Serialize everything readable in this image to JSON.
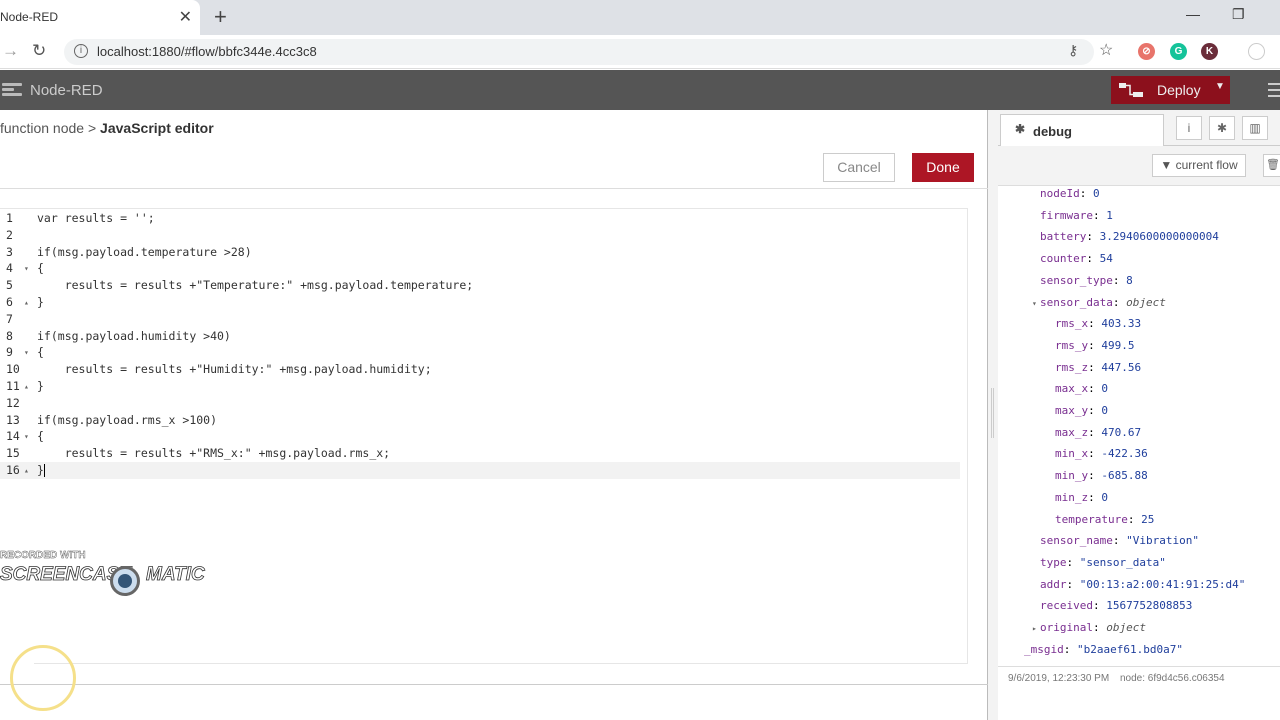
{
  "browser": {
    "tab_title": "Node-RED",
    "url": "localhost:1880/#flow/bbfc344e.4cc3c8"
  },
  "header": {
    "title": "Node-RED",
    "deploy_label": "Deploy"
  },
  "editor": {
    "breadcrumb_parent": "function node",
    "breadcrumb_sep": ">",
    "breadcrumb_current": "JavaScript editor",
    "cancel_label": "Cancel",
    "done_label": "Done",
    "lines": [
      {
        "n": "1",
        "fold": "",
        "text": "var results = '';"
      },
      {
        "n": "2",
        "fold": "",
        "text": ""
      },
      {
        "n": "3",
        "fold": "",
        "text": "if(msg.payload.temperature >28)"
      },
      {
        "n": "4",
        "fold": "▾",
        "text": "{"
      },
      {
        "n": "5",
        "fold": "",
        "text": "    results = results +\"Temperature:\" +msg.payload.temperature;"
      },
      {
        "n": "6",
        "fold": "▴",
        "text": "}"
      },
      {
        "n": "7",
        "fold": "",
        "text": ""
      },
      {
        "n": "8",
        "fold": "",
        "text": "if(msg.payload.humidity >40)"
      },
      {
        "n": "9",
        "fold": "▾",
        "text": "{"
      },
      {
        "n": "10",
        "fold": "",
        "text": "    results = results +\"Humidity:\" +msg.payload.humidity;"
      },
      {
        "n": "11",
        "fold": "▴",
        "text": "}"
      },
      {
        "n": "12",
        "fold": "",
        "text": ""
      },
      {
        "n": "13",
        "fold": "",
        "text": "if(msg.payload.rms_x >100)"
      },
      {
        "n": "14",
        "fold": "▾",
        "text": "{"
      },
      {
        "n": "15",
        "fold": "",
        "text": "    results = results +\"RMS_x:\" +msg.payload.rms_x;"
      },
      {
        "n": "16",
        "fold": "▴",
        "text": "}"
      }
    ]
  },
  "watermark": {
    "recorded_with": "RECORDED WITH",
    "brand_left": "SCREENCAST",
    "brand_right": "MATIC"
  },
  "sidebar": {
    "tab_label": "debug",
    "filter_label": "current flow",
    "debug_lines": [
      {
        "indent": 1,
        "key": "nodeId",
        "val": "0",
        "type": "num"
      },
      {
        "indent": 1,
        "key": "firmware",
        "val": "1",
        "type": "num"
      },
      {
        "indent": 1,
        "key": "battery",
        "val": "3.2940600000000004",
        "type": "num"
      },
      {
        "indent": 1,
        "key": "counter",
        "val": "54",
        "type": "num"
      },
      {
        "indent": 1,
        "key": "sensor_type",
        "val": "8",
        "type": "num"
      },
      {
        "indent": 1,
        "key": "sensor_data",
        "val": "object",
        "type": "obj",
        "expanded": true
      },
      {
        "indent": 2,
        "key": "rms_x",
        "val": "403.33",
        "type": "num"
      },
      {
        "indent": 2,
        "key": "rms_y",
        "val": "499.5",
        "type": "num"
      },
      {
        "indent": 2,
        "key": "rms_z",
        "val": "447.56",
        "type": "num"
      },
      {
        "indent": 2,
        "key": "max_x",
        "val": "0",
        "type": "num"
      },
      {
        "indent": 2,
        "key": "max_y",
        "val": "0",
        "type": "num"
      },
      {
        "indent": 2,
        "key": "max_z",
        "val": "470.67",
        "type": "num"
      },
      {
        "indent": 2,
        "key": "min_x",
        "val": "-422.36",
        "type": "num"
      },
      {
        "indent": 2,
        "key": "min_y",
        "val": "-685.88",
        "type": "num"
      },
      {
        "indent": 2,
        "key": "min_z",
        "val": "0",
        "type": "num"
      },
      {
        "indent": 2,
        "key": "temperature",
        "val": "25",
        "type": "num"
      },
      {
        "indent": 1,
        "key": "sensor_name",
        "val": "\"Vibration\"",
        "type": "str"
      },
      {
        "indent": 1,
        "key": "type",
        "val": "\"sensor_data\"",
        "type": "str"
      },
      {
        "indent": 1,
        "key": "addr",
        "val": "\"00:13:a2:00:41:91:25:d4\"",
        "type": "str"
      },
      {
        "indent": 1,
        "key": "received",
        "val": "1567752808853",
        "type": "num"
      },
      {
        "indent": 1,
        "key": "original",
        "val": "object",
        "type": "obj",
        "expanded": false
      },
      {
        "indent": 0,
        "key": "_msgid",
        "val": "\"b2aaef61.bd0a7\"",
        "type": "str"
      }
    ],
    "footer_time": "9/6/2019, 12:23:30 PM",
    "footer_node": "node: 6f9d4c56.c06354"
  }
}
